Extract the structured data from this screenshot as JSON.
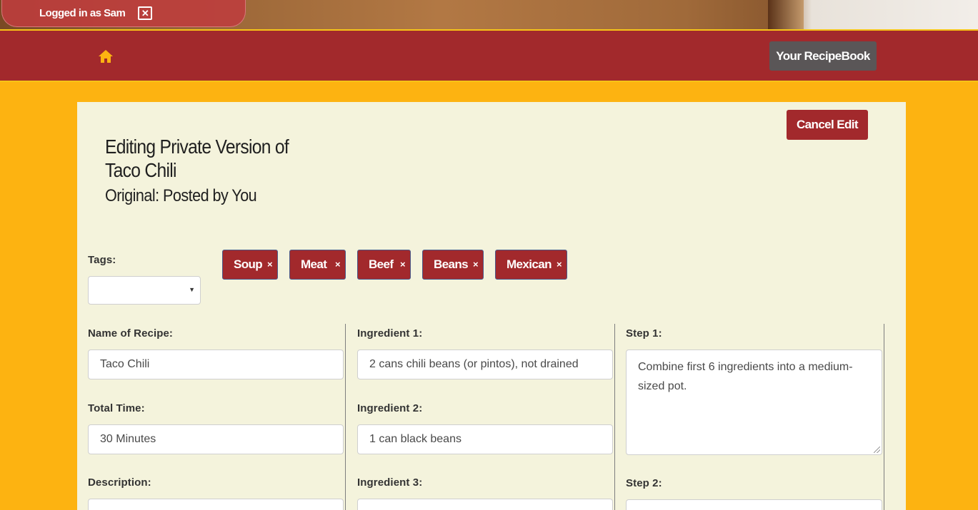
{
  "session": {
    "logged_in_text": "Logged in as Sam",
    "close_symbol": "✕"
  },
  "nav": {
    "home_icon": "home-icon",
    "recipebook_label": "Your RecipeBook"
  },
  "header": {
    "title_line1": "Editing Private Version of",
    "title_line2": "Taco Chili",
    "subtitle": "Original: Posted by You",
    "cancel_label": "Cancel Edit"
  },
  "tags": {
    "label": "Tags:",
    "selected_value": "",
    "items": [
      {
        "label": "Soup",
        "remove": "×"
      },
      {
        "label": "Meat",
        "remove": "×"
      },
      {
        "label": "Beef",
        "remove": "×"
      },
      {
        "label": "Beans",
        "remove": "×"
      },
      {
        "label": "Mexican",
        "remove": "×"
      }
    ]
  },
  "recipe": {
    "name_label": "Name of Recipe:",
    "name_value": "Taco Chili",
    "time_label": "Total Time:",
    "time_value": "30 Minutes",
    "description_label": "Description:",
    "description_value": ""
  },
  "ingredients": [
    {
      "label": "Ingredient 1:",
      "value": "2 cans chili beans (or pintos), not drained"
    },
    {
      "label": "Ingredient 2:",
      "value": "1 can black beans"
    },
    {
      "label": "Ingredient 3:",
      "value": ""
    }
  ],
  "steps": [
    {
      "label": "Step 1:",
      "value": "Combine first 6 ingredients into a medium-sized pot."
    },
    {
      "label": "Step 2:",
      "value": ""
    }
  ],
  "colors": {
    "page_background": "#fdb311",
    "nav_red": "#a2292c",
    "panel": "#f4f3dc",
    "recipebook_button": "#5a5657",
    "home_icon": "#fdb311"
  }
}
